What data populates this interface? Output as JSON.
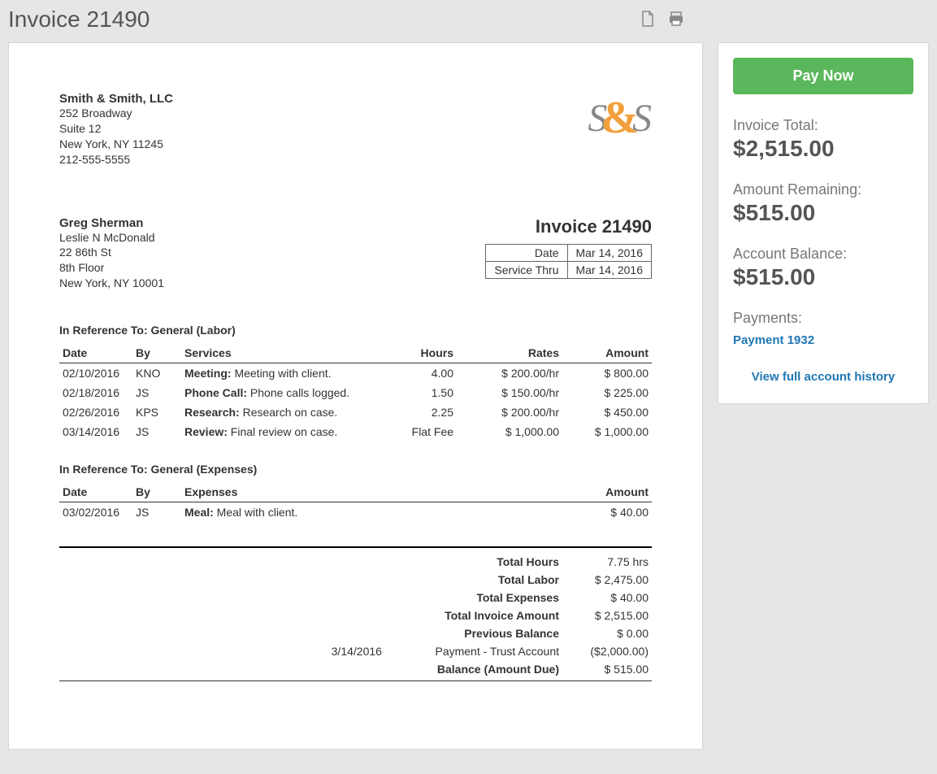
{
  "page_title": "Invoice 21490",
  "from": {
    "name": "Smith & Smith, LLC",
    "line1": "252 Broadway",
    "line2": "Suite 12",
    "line3": "New York, NY 11245",
    "phone": "212-555-5555"
  },
  "to": {
    "name": "Greg Sherman",
    "line1": "Leslie N McDonald",
    "line2": "22 86th St",
    "line3": "8th Floor",
    "line4": "New York, NY 10001"
  },
  "invoice_title": "Invoice 21490",
  "dates": {
    "date_label": "Date",
    "date_value": "Mar 14, 2016",
    "thru_label": "Service Thru",
    "thru_value": "Mar 14, 2016"
  },
  "labor_heading": "In Reference To: General (Labor)",
  "labor_columns": {
    "date": "Date",
    "by": "By",
    "services": "Services",
    "hours": "Hours",
    "rates": "Rates",
    "amount": "Amount"
  },
  "labor_items": [
    {
      "date": "02/10/2016",
      "by": "KNO",
      "type": "Meeting:",
      "desc": "Meeting with client.",
      "hours": "4.00",
      "rate": "$ 200.00/hr",
      "amount": "$ 800.00"
    },
    {
      "date": "02/18/2016",
      "by": "JS",
      "type": "Phone Call:",
      "desc": "Phone calls logged.",
      "hours": "1.50",
      "rate": "$ 150.00/hr",
      "amount": "$ 225.00"
    },
    {
      "date": "02/26/2016",
      "by": "KPS",
      "type": "Research:",
      "desc": "Research on case.",
      "hours": "2.25",
      "rate": "$ 200.00/hr",
      "amount": "$ 450.00"
    },
    {
      "date": "03/14/2016",
      "by": "JS",
      "type": "Review:",
      "desc": "Final review on case.",
      "hours": "Flat Fee",
      "rate": "$ 1,000.00",
      "amount": "$ 1,000.00"
    }
  ],
  "expense_heading": "In Reference To: General (Expenses)",
  "expense_columns": {
    "date": "Date",
    "by": "By",
    "expenses": "Expenses",
    "amount": "Amount"
  },
  "expense_items": [
    {
      "date": "03/02/2016",
      "by": "JS",
      "type": "Meal:",
      "desc": "Meal with client.",
      "amount": "$ 40.00"
    }
  ],
  "totals": {
    "hours_label": "Total Hours",
    "hours_value": "7.75 hrs",
    "labor_label": "Total Labor",
    "labor_value": "$ 2,475.00",
    "exp_label": "Total Expenses",
    "exp_value": "$ 40.00",
    "inv_label": "Total Invoice Amount",
    "inv_value": "$ 2,515.00",
    "prev_label": "Previous Balance",
    "prev_value": "$ 0.00",
    "payment_date": "3/14/2016",
    "payment_label": "Payment - Trust Account",
    "payment_value": "($2,000.00)",
    "bal_label": "Balance (Amount Due)",
    "bal_value": "$ 515.00"
  },
  "sidebar": {
    "pay_label": "Pay Now",
    "inv_total_label": "Invoice Total:",
    "inv_total_value": "$2,515.00",
    "remain_label": "Amount Remaining:",
    "remain_value": "$515.00",
    "acct_label": "Account Balance:",
    "acct_value": "$515.00",
    "payments_label": "Payments:",
    "payment_link": "Payment 1932",
    "history_link": "View full account history"
  }
}
